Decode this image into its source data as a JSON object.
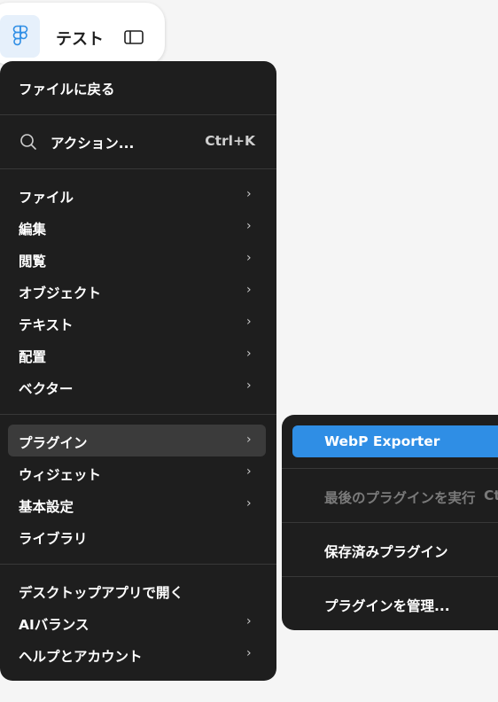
{
  "header": {
    "title": "テスト",
    "logo_icon": "figma-logo-icon",
    "panel_icon": "sidebar-toggle-icon"
  },
  "menu": {
    "back_label": "ファイルに戻る",
    "actions": {
      "label": "アクション...",
      "shortcut": "Ctrl+K",
      "icon": "search-icon"
    },
    "items_group1": [
      {
        "label": "ファイル",
        "submenu": true
      },
      {
        "label": "編集",
        "submenu": true
      },
      {
        "label": "閲覧",
        "submenu": true
      },
      {
        "label": "オブジェクト",
        "submenu": true
      },
      {
        "label": "テキスト",
        "submenu": true
      },
      {
        "label": "配置",
        "submenu": true
      },
      {
        "label": "ベクター",
        "submenu": true
      }
    ],
    "items_group2": [
      {
        "label": "プラグイン",
        "submenu": true,
        "active": true
      },
      {
        "label": "ウィジェット",
        "submenu": true
      },
      {
        "label": "基本設定",
        "submenu": true
      },
      {
        "label": "ライブラリ",
        "submenu": false
      }
    ],
    "items_group3": [
      {
        "label": "デスクトップアプリで開く",
        "submenu": false
      },
      {
        "label": "AIバランス",
        "submenu": true
      },
      {
        "label": "ヘルプとアカウント",
        "submenu": true
      }
    ],
    "chevron": "›"
  },
  "submenu": {
    "items": [
      {
        "label": "WebP Exporter",
        "highlighted": true
      },
      {
        "label": "最後のプラグインを実行",
        "disabled": true,
        "shortcut": "Ct"
      },
      {
        "label": "保存済みプラグイン"
      },
      {
        "label": "プラグインを管理..."
      }
    ]
  },
  "colors": {
    "menu_bg": "#1e1e1e",
    "highlight": "#2f8ee5",
    "active_row": "#3b3b3b",
    "page_bg": "#f5f5f5"
  }
}
